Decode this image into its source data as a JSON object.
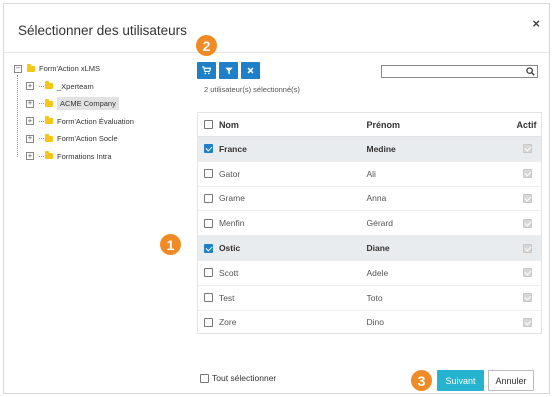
{
  "dialog": {
    "title": "Sélectionner des utilisateurs",
    "close_glyph": "×"
  },
  "tree": {
    "root": {
      "label": "Form'Action xLMS",
      "toggle": "−"
    },
    "items": [
      {
        "label": "_Xperteam",
        "toggle": "+"
      },
      {
        "label": "ACME Company",
        "toggle": "+",
        "selected": true
      },
      {
        "label": "Form'Action Évaluation",
        "toggle": "+"
      },
      {
        "label": "Form'Action Socle",
        "toggle": "+"
      },
      {
        "label": "Formations Intra",
        "toggle": "+"
      }
    ]
  },
  "badges": {
    "one": "1",
    "two": "2",
    "three": "3"
  },
  "toolbar": {
    "cart_icon": "cart-icon",
    "filter_icon": "filter-icon",
    "clear_icon": "close-icon",
    "selected_count": "2 utilisateur(s) sélectionné(s)",
    "search_value": ""
  },
  "grid": {
    "headers": {
      "nom": "Nom",
      "prenom": "Prénom",
      "actif": "Actif"
    },
    "rows": [
      {
        "nom": "France",
        "prenom": "Medine",
        "checked": true
      },
      {
        "nom": "Gator",
        "prenom": "Ali",
        "checked": false
      },
      {
        "nom": "Grame",
        "prenom": "Anna",
        "checked": false
      },
      {
        "nom": "Menfin",
        "prenom": "Gérard",
        "checked": false
      },
      {
        "nom": "Ostic",
        "prenom": "Diane",
        "checked": true
      },
      {
        "nom": "Scott",
        "prenom": "Adele",
        "checked": false
      },
      {
        "nom": "Test",
        "prenom": "Toto",
        "checked": false
      },
      {
        "nom": "Zore",
        "prenom": "Dino",
        "checked": false
      }
    ]
  },
  "footer": {
    "select_all": "Tout sélectionner",
    "next": "Suivant",
    "cancel": "Annuler"
  },
  "colors": {
    "primary": "#1f7fc9",
    "next_button": "#26b3cf",
    "badge": "#f08a24",
    "folder": "#f5c518"
  }
}
